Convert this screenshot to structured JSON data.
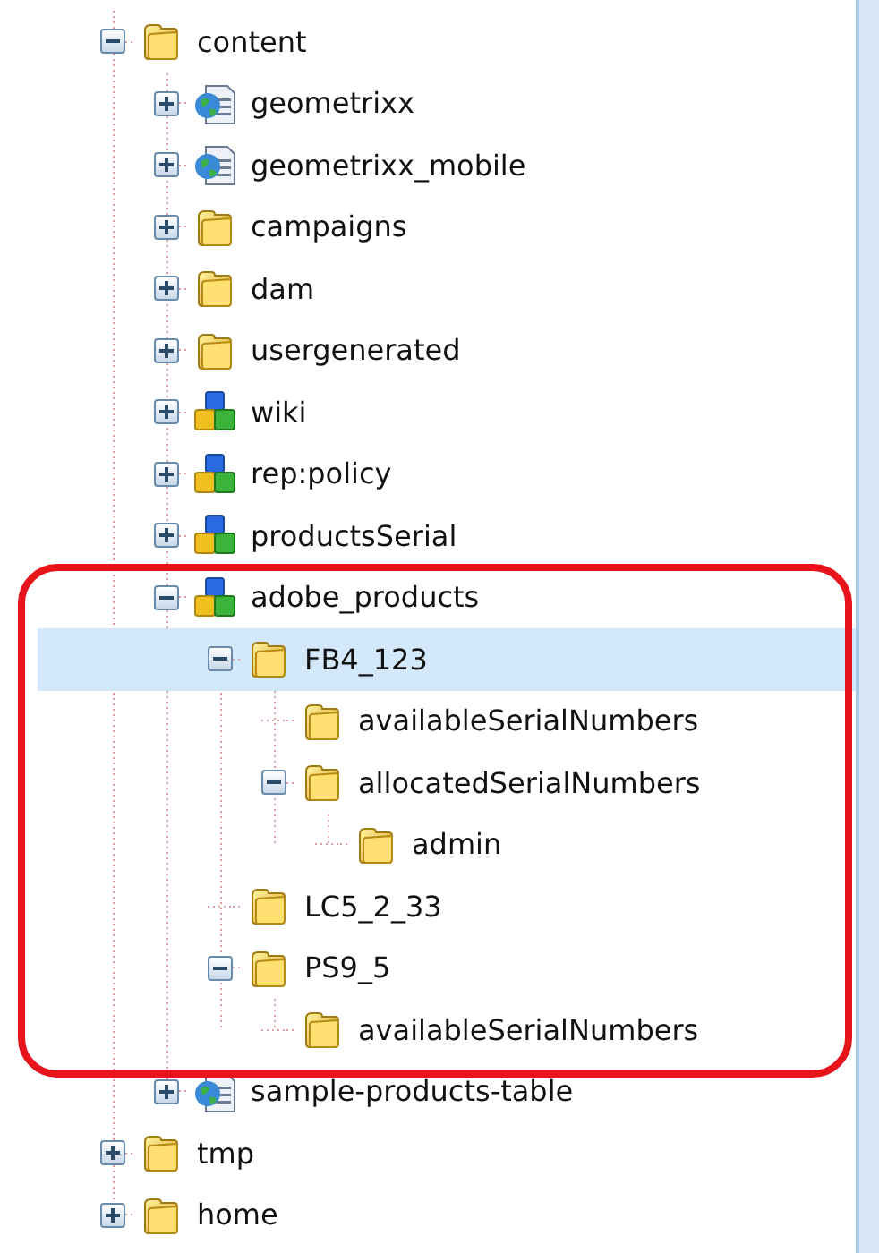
{
  "tree": [
    {
      "label": "content",
      "kind": "folder",
      "expanded": true,
      "selected": false,
      "children": [
        {
          "label": "geometrixx",
          "kind": "page",
          "expanded": false,
          "selected": false
        },
        {
          "label": "geometrixx_mobile",
          "kind": "page",
          "expanded": false,
          "selected": false
        },
        {
          "label": "campaigns",
          "kind": "folder",
          "expanded": false,
          "selected": false
        },
        {
          "label": "dam",
          "kind": "folder",
          "expanded": false,
          "selected": false
        },
        {
          "label": "usergenerated",
          "kind": "folder",
          "expanded": false,
          "selected": false
        },
        {
          "label": "wiki",
          "kind": "blocks",
          "expanded": false,
          "selected": false
        },
        {
          "label": "rep:policy",
          "kind": "blocks",
          "expanded": false,
          "selected": false
        },
        {
          "label": "productsSerial",
          "kind": "blocks",
          "expanded": false,
          "selected": false
        },
        {
          "label": "adobe_products",
          "kind": "blocks",
          "expanded": true,
          "selected": false,
          "highlighted": true,
          "children": [
            {
              "label": "FB4_123",
              "kind": "folder",
              "expanded": true,
              "selected": true,
              "children": [
                {
                  "label": "availableSerialNumbers",
                  "kind": "folder",
                  "selected": false
                },
                {
                  "label": "allocatedSerialNumbers",
                  "kind": "folder",
                  "expanded": true,
                  "selected": false,
                  "children": [
                    {
                      "label": "admin",
                      "kind": "folder",
                      "selected": false
                    }
                  ]
                }
              ]
            },
            {
              "label": "LC5_2_33",
              "kind": "folder",
              "selected": false
            },
            {
              "label": "PS9_5",
              "kind": "folder",
              "expanded": true,
              "selected": false,
              "children": [
                {
                  "label": "availableSerialNumbers",
                  "kind": "folder",
                  "selected": false
                }
              ]
            }
          ]
        },
        {
          "label": "sample-products-table",
          "kind": "page",
          "expanded": false,
          "selected": false
        }
      ]
    },
    {
      "label": "tmp",
      "kind": "folder",
      "expanded": false,
      "selected": false
    },
    {
      "label": "home",
      "kind": "folder",
      "expanded": false,
      "selected": false
    }
  ]
}
